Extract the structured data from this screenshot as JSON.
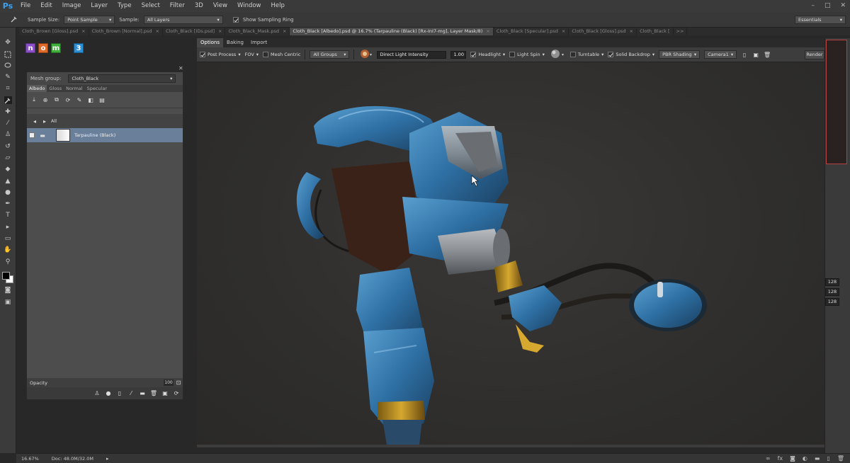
{
  "app": {
    "logo": "Ps"
  },
  "menu": [
    "File",
    "Edit",
    "Image",
    "Layer",
    "Type",
    "Select",
    "Filter",
    "3D",
    "View",
    "Window",
    "Help"
  ],
  "window_controls": [
    "–",
    "□",
    "✕"
  ],
  "options_bar": {
    "sample_size_label": "Sample Size:",
    "sample_size_value": "Point Sample",
    "sample_label": "Sample:",
    "sample_value": "All Layers",
    "show_sampling_ring": "Show Sampling Ring",
    "workspace": "Essentials"
  },
  "doc_tabs": [
    {
      "label": "Cloth_Brown [Gloss].psd",
      "active": false
    },
    {
      "label": "Cloth_Brown [Normal].psd",
      "active": false
    },
    {
      "label": "Cloth_Black [IDs.psd]",
      "active": false
    },
    {
      "label": "Cloth_Black_Mask.psd",
      "active": false
    },
    {
      "label": "Cloth_Black [Albedo].psd @ 16.7% (Tarpauline (Black) [Rx-InI7-mg], Layer Mask/8)",
      "active": true
    },
    {
      "label": "Cloth_Black [Specular].psd",
      "active": false
    },
    {
      "label": "Cloth_Black [Gloss].psd",
      "active": false
    },
    {
      "label": "Cloth_Black [",
      "active": false
    }
  ],
  "tab_overflow": ">>",
  "knald": {
    "badges": [
      {
        "letter": "n",
        "color": "#8a4fc9"
      },
      {
        "letter": "o",
        "color": "#e06a2a"
      },
      {
        "letter": "m",
        "color": "#3fae3b"
      },
      {
        "letter": "3",
        "color": "#2a8fd6"
      }
    ],
    "mesh_group_label": "Mesh group:",
    "mesh_group_value": "Cloth_Black",
    "channels": [
      "Albedo",
      "Gloss",
      "Normal",
      "Specular"
    ],
    "all_label": "All",
    "layer_name": "Tarpauline (Black)",
    "opacity_label": "Opacity",
    "opacity_value": "100"
  },
  "viewport": {
    "tabs": [
      "Options",
      "Baking",
      "Import"
    ],
    "post_process": "Post Process",
    "fov": "FOV",
    "mesh_centric": "Mesh Centric",
    "groups": "All Groups",
    "light_field": "Direct Light Intensity",
    "light_value": "1.00",
    "headlight": "Headlight",
    "light_spin": "Light Spin",
    "turntable": "Turntable",
    "solid_backdrop": "Solid Backdrop",
    "shading": "PBR Shading",
    "camera": "Camera1",
    "render": "Render"
  },
  "right_dock": {
    "values": [
      "128",
      "128",
      "128"
    ]
  },
  "status": {
    "zoom": "16.67%",
    "doc": "Doc: 48.0M/32.0M"
  },
  "colors": {
    "accent": "#3ea2f0",
    "selection": "#6a7f9a",
    "robot_blue": "#2e6fa3"
  }
}
